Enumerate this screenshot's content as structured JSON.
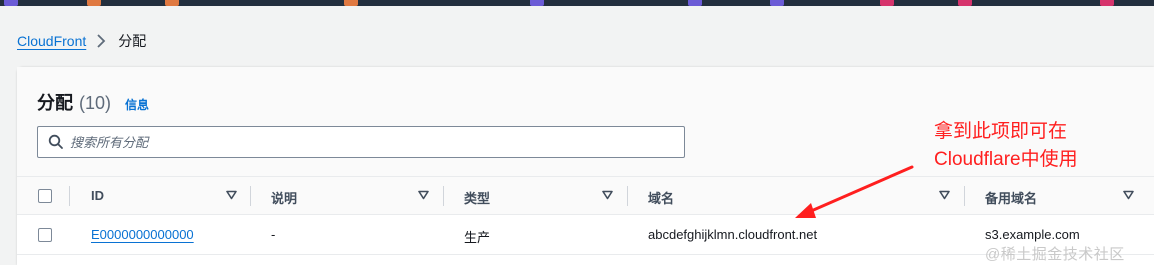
{
  "colors": {
    "link": "#0972d3",
    "annotation": "#ff1f1f",
    "header_bg": "#fafafa",
    "page_bg": "#f2f3f3"
  },
  "breadcrumb": {
    "root": "CloudFront",
    "current": "分配"
  },
  "header": {
    "title": "分配",
    "count": "(10)",
    "info": "信息"
  },
  "search": {
    "placeholder": "搜索所有分配",
    "value": ""
  },
  "table": {
    "columns": [
      "ID",
      "说明",
      "类型",
      "域名",
      "备用域名"
    ],
    "rows": [
      {
        "id": "E0000000000000",
        "description": "-",
        "type": "生产",
        "domain": "abcdefghijklmn.cloudfront.net",
        "alt_domain": "s3.example.com"
      }
    ]
  },
  "annotation": {
    "line1": "拿到此项即可在",
    "line2": "Cloudflare中使用"
  },
  "watermark": "@稀土掘金技术社区"
}
